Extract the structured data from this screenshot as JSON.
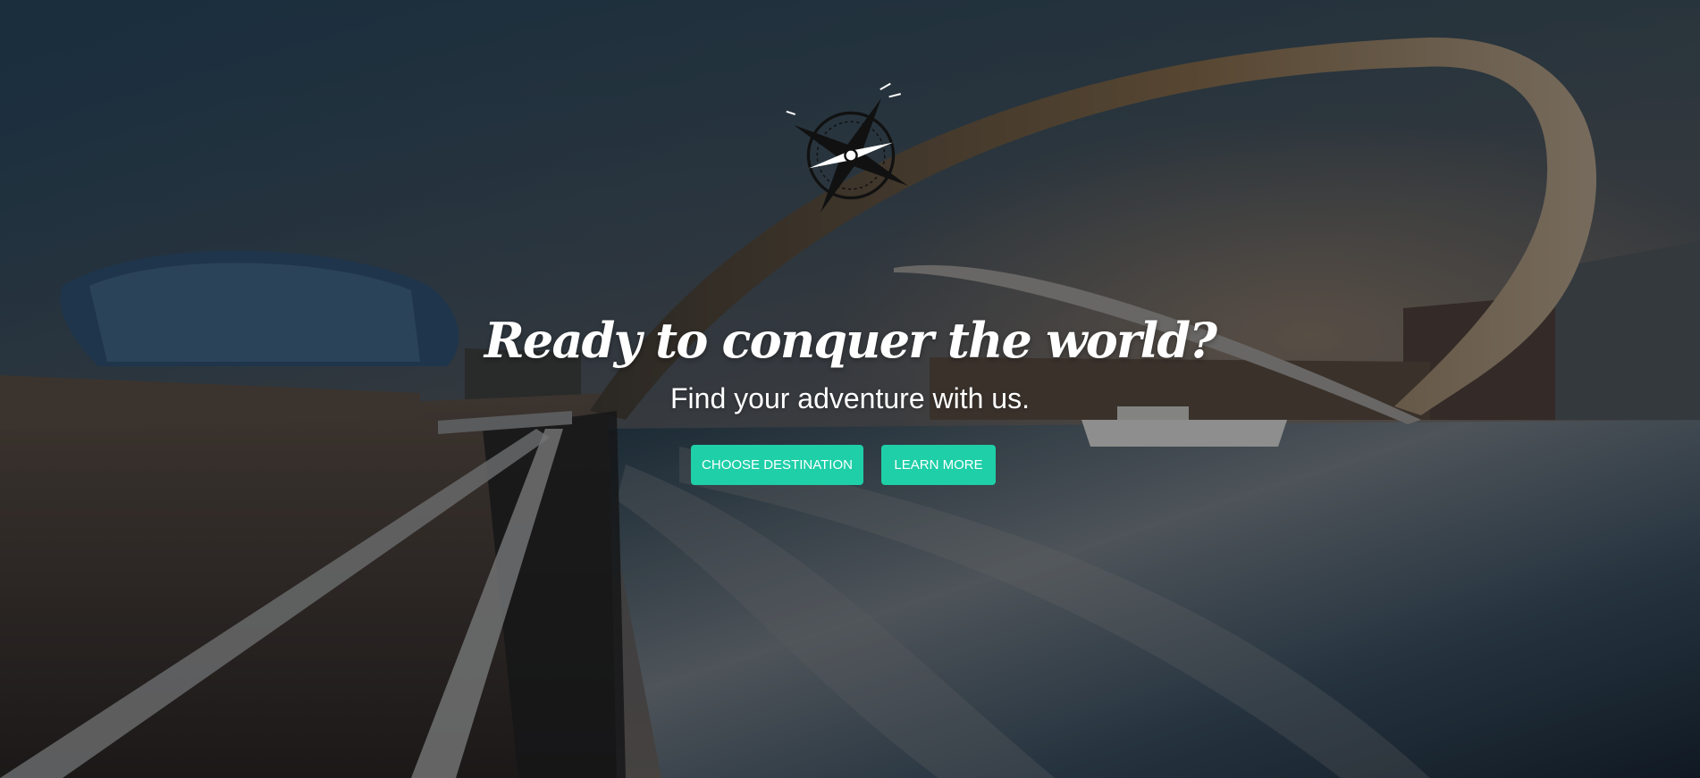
{
  "hero": {
    "headline": "Ready to conquer the world?",
    "subheadline": "Find your adventure with us.",
    "logo_icon": "compass-icon",
    "background_description": "Millennium Bridge and waterfront at sunset with dark overlay"
  },
  "actions": {
    "choose_destination_label": "CHOOSE DESTINATION",
    "learn_more_label": "LEARN MORE"
  },
  "colors": {
    "accent": "#1ecfa8",
    "overlay": "#1a1f26",
    "text": "#ffffff"
  }
}
